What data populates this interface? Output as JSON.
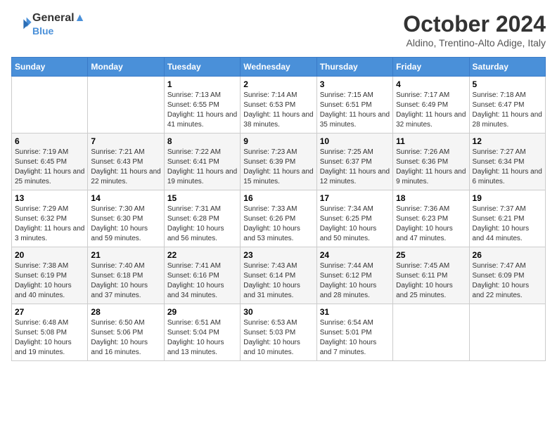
{
  "header": {
    "logo_line1": "General",
    "logo_line2": "Blue",
    "month_title": "October 2024",
    "location": "Aldino, Trentino-Alto Adige, Italy"
  },
  "days_of_week": [
    "Sunday",
    "Monday",
    "Tuesday",
    "Wednesday",
    "Thursday",
    "Friday",
    "Saturday"
  ],
  "weeks": [
    [
      {
        "day": "",
        "sunrise": "",
        "sunset": "",
        "daylight": ""
      },
      {
        "day": "",
        "sunrise": "",
        "sunset": "",
        "daylight": ""
      },
      {
        "day": "1",
        "sunrise": "Sunrise: 7:13 AM",
        "sunset": "Sunset: 6:55 PM",
        "daylight": "Daylight: 11 hours and 41 minutes."
      },
      {
        "day": "2",
        "sunrise": "Sunrise: 7:14 AM",
        "sunset": "Sunset: 6:53 PM",
        "daylight": "Daylight: 11 hours and 38 minutes."
      },
      {
        "day": "3",
        "sunrise": "Sunrise: 7:15 AM",
        "sunset": "Sunset: 6:51 PM",
        "daylight": "Daylight: 11 hours and 35 minutes."
      },
      {
        "day": "4",
        "sunrise": "Sunrise: 7:17 AM",
        "sunset": "Sunset: 6:49 PM",
        "daylight": "Daylight: 11 hours and 32 minutes."
      },
      {
        "day": "5",
        "sunrise": "Sunrise: 7:18 AM",
        "sunset": "Sunset: 6:47 PM",
        "daylight": "Daylight: 11 hours and 28 minutes."
      }
    ],
    [
      {
        "day": "6",
        "sunrise": "Sunrise: 7:19 AM",
        "sunset": "Sunset: 6:45 PM",
        "daylight": "Daylight: 11 hours and 25 minutes."
      },
      {
        "day": "7",
        "sunrise": "Sunrise: 7:21 AM",
        "sunset": "Sunset: 6:43 PM",
        "daylight": "Daylight: 11 hours and 22 minutes."
      },
      {
        "day": "8",
        "sunrise": "Sunrise: 7:22 AM",
        "sunset": "Sunset: 6:41 PM",
        "daylight": "Daylight: 11 hours and 19 minutes."
      },
      {
        "day": "9",
        "sunrise": "Sunrise: 7:23 AM",
        "sunset": "Sunset: 6:39 PM",
        "daylight": "Daylight: 11 hours and 15 minutes."
      },
      {
        "day": "10",
        "sunrise": "Sunrise: 7:25 AM",
        "sunset": "Sunset: 6:37 PM",
        "daylight": "Daylight: 11 hours and 12 minutes."
      },
      {
        "day": "11",
        "sunrise": "Sunrise: 7:26 AM",
        "sunset": "Sunset: 6:36 PM",
        "daylight": "Daylight: 11 hours and 9 minutes."
      },
      {
        "day": "12",
        "sunrise": "Sunrise: 7:27 AM",
        "sunset": "Sunset: 6:34 PM",
        "daylight": "Daylight: 11 hours and 6 minutes."
      }
    ],
    [
      {
        "day": "13",
        "sunrise": "Sunrise: 7:29 AM",
        "sunset": "Sunset: 6:32 PM",
        "daylight": "Daylight: 11 hours and 3 minutes."
      },
      {
        "day": "14",
        "sunrise": "Sunrise: 7:30 AM",
        "sunset": "Sunset: 6:30 PM",
        "daylight": "Daylight: 10 hours and 59 minutes."
      },
      {
        "day": "15",
        "sunrise": "Sunrise: 7:31 AM",
        "sunset": "Sunset: 6:28 PM",
        "daylight": "Daylight: 10 hours and 56 minutes."
      },
      {
        "day": "16",
        "sunrise": "Sunrise: 7:33 AM",
        "sunset": "Sunset: 6:26 PM",
        "daylight": "Daylight: 10 hours and 53 minutes."
      },
      {
        "day": "17",
        "sunrise": "Sunrise: 7:34 AM",
        "sunset": "Sunset: 6:25 PM",
        "daylight": "Daylight: 10 hours and 50 minutes."
      },
      {
        "day": "18",
        "sunrise": "Sunrise: 7:36 AM",
        "sunset": "Sunset: 6:23 PM",
        "daylight": "Daylight: 10 hours and 47 minutes."
      },
      {
        "day": "19",
        "sunrise": "Sunrise: 7:37 AM",
        "sunset": "Sunset: 6:21 PM",
        "daylight": "Daylight: 10 hours and 44 minutes."
      }
    ],
    [
      {
        "day": "20",
        "sunrise": "Sunrise: 7:38 AM",
        "sunset": "Sunset: 6:19 PM",
        "daylight": "Daylight: 10 hours and 40 minutes."
      },
      {
        "day": "21",
        "sunrise": "Sunrise: 7:40 AM",
        "sunset": "Sunset: 6:18 PM",
        "daylight": "Daylight: 10 hours and 37 minutes."
      },
      {
        "day": "22",
        "sunrise": "Sunrise: 7:41 AM",
        "sunset": "Sunset: 6:16 PM",
        "daylight": "Daylight: 10 hours and 34 minutes."
      },
      {
        "day": "23",
        "sunrise": "Sunrise: 7:43 AM",
        "sunset": "Sunset: 6:14 PM",
        "daylight": "Daylight: 10 hours and 31 minutes."
      },
      {
        "day": "24",
        "sunrise": "Sunrise: 7:44 AM",
        "sunset": "Sunset: 6:12 PM",
        "daylight": "Daylight: 10 hours and 28 minutes."
      },
      {
        "day": "25",
        "sunrise": "Sunrise: 7:45 AM",
        "sunset": "Sunset: 6:11 PM",
        "daylight": "Daylight: 10 hours and 25 minutes."
      },
      {
        "day": "26",
        "sunrise": "Sunrise: 7:47 AM",
        "sunset": "Sunset: 6:09 PM",
        "daylight": "Daylight: 10 hours and 22 minutes."
      }
    ],
    [
      {
        "day": "27",
        "sunrise": "Sunrise: 6:48 AM",
        "sunset": "Sunset: 5:08 PM",
        "daylight": "Daylight: 10 hours and 19 minutes."
      },
      {
        "day": "28",
        "sunrise": "Sunrise: 6:50 AM",
        "sunset": "Sunset: 5:06 PM",
        "daylight": "Daylight: 10 hours and 16 minutes."
      },
      {
        "day": "29",
        "sunrise": "Sunrise: 6:51 AM",
        "sunset": "Sunset: 5:04 PM",
        "daylight": "Daylight: 10 hours and 13 minutes."
      },
      {
        "day": "30",
        "sunrise": "Sunrise: 6:53 AM",
        "sunset": "Sunset: 5:03 PM",
        "daylight": "Daylight: 10 hours and 10 minutes."
      },
      {
        "day": "31",
        "sunrise": "Sunrise: 6:54 AM",
        "sunset": "Sunset: 5:01 PM",
        "daylight": "Daylight: 10 hours and 7 minutes."
      },
      {
        "day": "",
        "sunrise": "",
        "sunset": "",
        "daylight": ""
      },
      {
        "day": "",
        "sunrise": "",
        "sunset": "",
        "daylight": ""
      }
    ]
  ]
}
